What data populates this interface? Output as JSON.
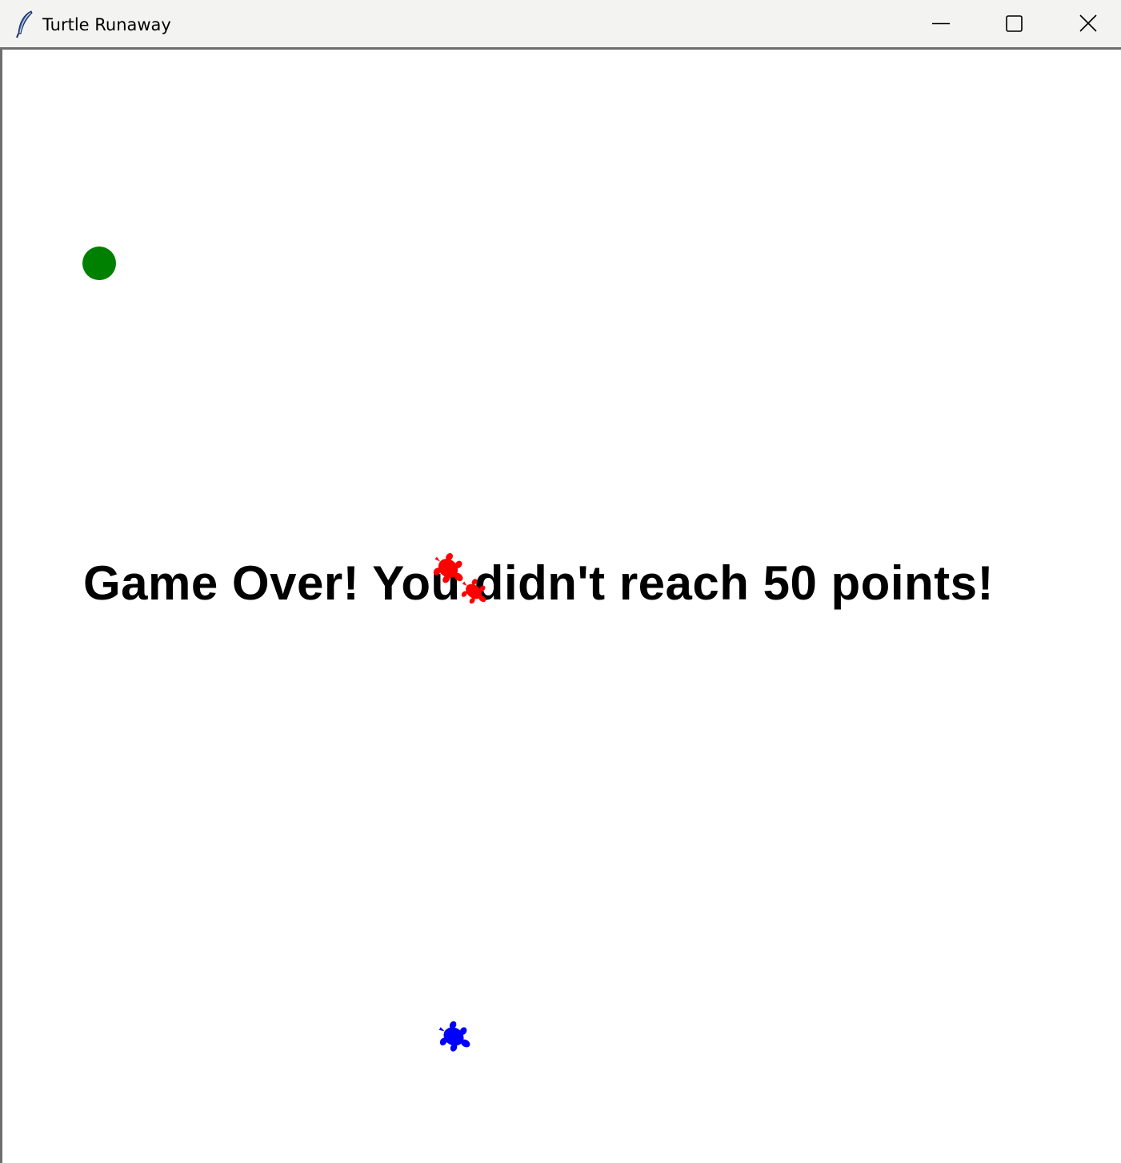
{
  "window": {
    "title": "Turtle Runaway",
    "controls": {
      "minimize": "minimize-icon",
      "maximize": "maximize-icon",
      "close": "close-icon"
    },
    "app_icon": "feather-icon"
  },
  "game": {
    "message": "Game Over! You didn't reach 50 points!",
    "colors": {
      "food": "#008000",
      "chaser_turtle": "#ff0000",
      "runner_turtle": "#0000ff",
      "text": "#000000",
      "background": "#ffffff"
    }
  }
}
